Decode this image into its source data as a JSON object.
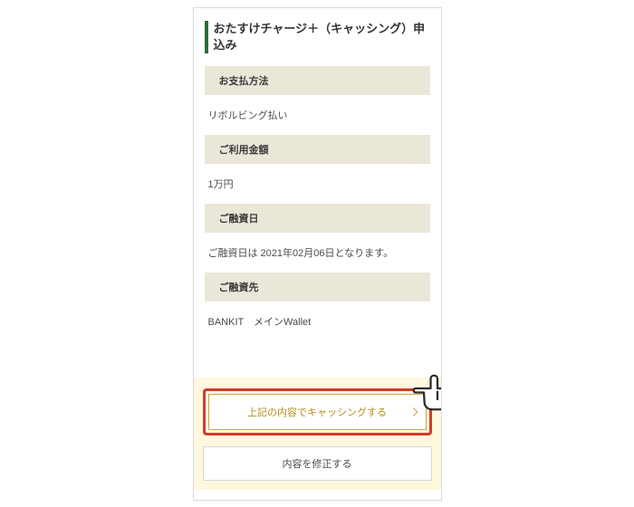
{
  "title": "おたすけチャージ＋（キャッシング）申込み",
  "sections": [
    {
      "header": "お支払方法",
      "value": "リボルビング払い"
    },
    {
      "header": "ご利用金額",
      "value": "1万円"
    },
    {
      "header": "ご融資日",
      "value": "ご融資日は  2021年02月06日となります。"
    },
    {
      "header": "ご融資先",
      "value": "BANKIT　メインWallet"
    }
  ],
  "buttons": {
    "primary": "上記の内容でキャッシングする",
    "secondary": "内容を修正する"
  }
}
